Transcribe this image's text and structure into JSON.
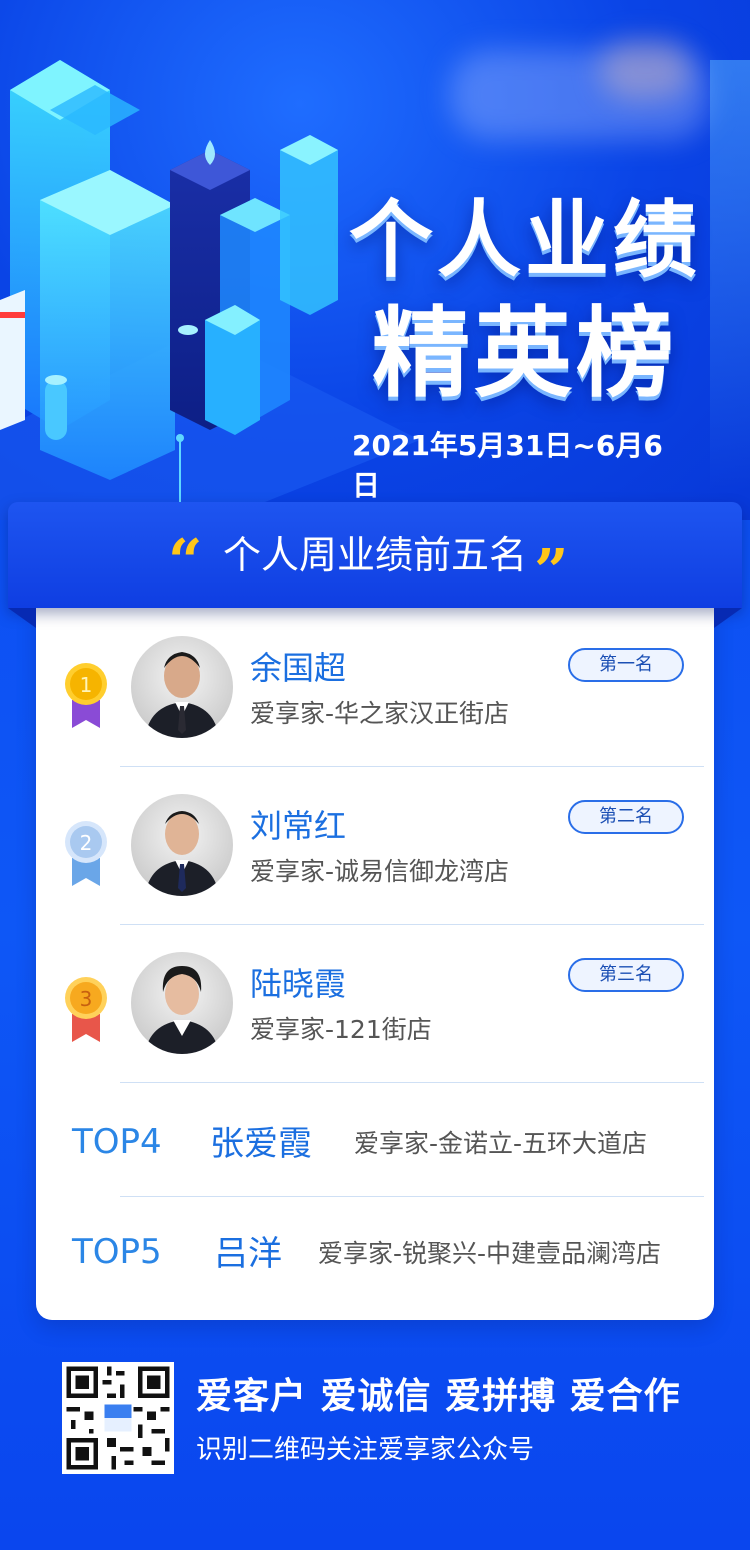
{
  "hero": {
    "title_line1": "个人业绩",
    "title_line2": "精英榜",
    "date_range": "2021年5月31日~6月6日"
  },
  "banner": {
    "open_quote": "“",
    "text": "个人周业绩前五名",
    "close_quote": "”"
  },
  "top3": [
    {
      "medal_number": "1",
      "name": "余国超",
      "store": "爱享家-华之家汉正街店",
      "badge": "第一名",
      "medal_color": "#f6b400",
      "ribbon_color": "#8a4bd6"
    },
    {
      "medal_number": "2",
      "name": "刘常红",
      "store": "爱享家-诚易信御龙湾店",
      "badge": "第二名",
      "medal_color": "#a9c9f0",
      "ribbon_color": "#6aa6e8"
    },
    {
      "medal_number": "3",
      "name": "陆晓霞",
      "store": "爱享家-121街店",
      "badge": "第三名",
      "medal_color": "#f7a91f",
      "ribbon_color": "#e8564a"
    }
  ],
  "others": [
    {
      "label": "TOP4",
      "name": "张爱霞",
      "store": "爱享家-金诺立-五环大道店"
    },
    {
      "label": "TOP5",
      "name": "吕洋",
      "store": "爱享家-锐聚兴-中建壹品澜湾店"
    }
  ],
  "footer": {
    "slogan": "爱客户 爱诚信 爱拼搏 爱合作",
    "follow_text": "识别二维码关注爱享家公众号"
  }
}
